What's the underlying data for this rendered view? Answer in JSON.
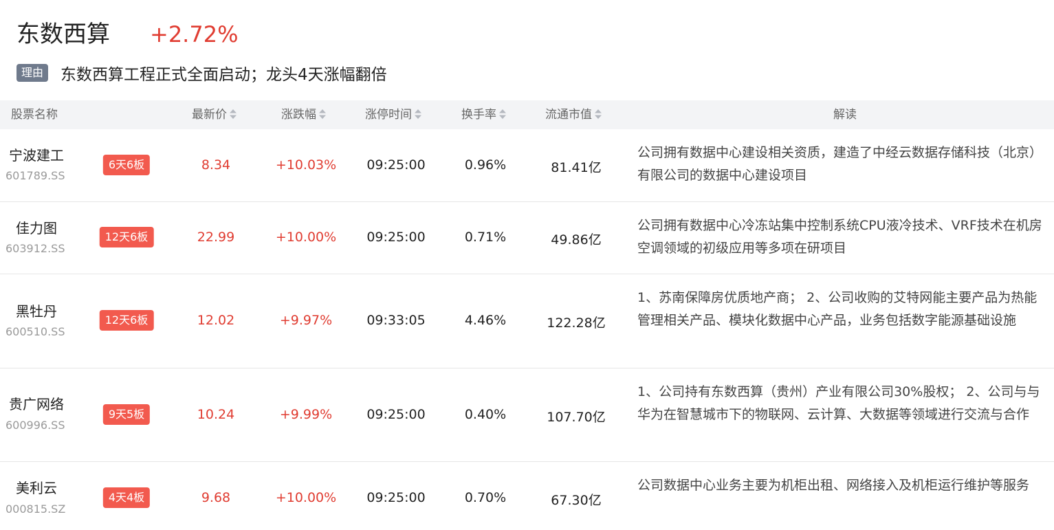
{
  "header": {
    "sector_name": "东数西算",
    "sector_change": "+2.72%"
  },
  "reason": {
    "tag": "理由",
    "text": "东数西算工程正式全面启动；龙头4天涨幅翻倍"
  },
  "table": {
    "columns": {
      "name": "股票名称",
      "price": "最新价",
      "change": "涨跌幅",
      "limit_time": "涨停时间",
      "turnover": "换手率",
      "market_cap": "流通市值",
      "analysis": "解读"
    },
    "rows": [
      {
        "name": "宁波建工",
        "code": "601789.SS",
        "badge": "6天6板",
        "price": "8.34",
        "change": "+10.03%",
        "limit_time": "09:25:00",
        "turnover": "0.96%",
        "market_cap": "81.41亿",
        "analysis": "公司拥有数据中心建设相关资质，建造了中经云数据存储科技（北京）有限公司的数据中心建设项目"
      },
      {
        "name": "佳力图",
        "code": "603912.SS",
        "badge": "12天6板",
        "price": "22.99",
        "change": "+10.00%",
        "limit_time": "09:25:00",
        "turnover": "0.71%",
        "market_cap": "49.86亿",
        "analysis": "公司拥有数据中心冷冻站集中控制系统CPU液冷技术、VRF技术在机房空调领域的初级应用等多项在研项目"
      },
      {
        "name": "黑牡丹",
        "code": "600510.SS",
        "badge": "12天6板",
        "price": "12.02",
        "change": "+9.97%",
        "limit_time": "09:33:05",
        "turnover": "4.46%",
        "market_cap": "122.28亿",
        "analysis": "1、苏南保障房优质地产商； 2、公司收购的艾特网能主要产品为热能管理相关产品、模块化数据中心产品，业务包括数字能源基础设施"
      },
      {
        "name": "贵广网络",
        "code": "600996.SS",
        "badge": "9天5板",
        "price": "10.24",
        "change": "+9.99%",
        "limit_time": "09:25:00",
        "turnover": "0.40%",
        "market_cap": "107.70亿",
        "analysis": "1、公司持有东数西算（贵州）产业有限公司30%股权； 2、公司与与华为在智慧城市下的物联网、云计算、大数据等领域进行交流与合作"
      },
      {
        "name": "美利云",
        "code": "000815.SZ",
        "badge": "4天4板",
        "price": "9.68",
        "change": "+10.00%",
        "limit_time": "09:25:00",
        "turnover": "0.70%",
        "market_cap": "67.30亿",
        "analysis": "公司数据中心业务主要为机柜出租、网络接入及机柜运行维护等服务"
      }
    ]
  },
  "colors": {
    "up": "#e03c31",
    "badge": "#f25a4e",
    "tag": "#6f7a8c",
    "header_bg": "#f3f4f6"
  }
}
